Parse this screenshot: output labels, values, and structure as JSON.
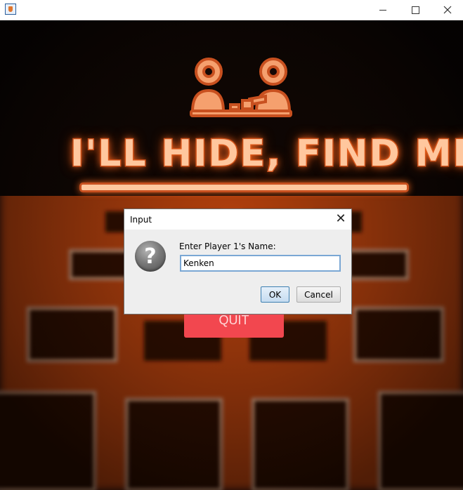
{
  "window": {
    "minimize_icon": "minimize-icon",
    "maximize_icon": "maximize-icon",
    "close_icon": "close-icon"
  },
  "game": {
    "title": "I'LL HIDE, FIND ME!",
    "quit_label": "QUIT",
    "colors": {
      "glow": "#f0651e",
      "title_fill": "#ffc79e",
      "title_stroke": "#c8501f",
      "quit_button": "#f2474f"
    }
  },
  "dialog": {
    "title": "Input",
    "close_glyph": "✕",
    "icon": "question-icon",
    "question_glyph": "?",
    "prompt": "Enter Player 1's Name:",
    "input_value": "Kenken",
    "ok_label": "OK",
    "cancel_label": "Cancel"
  }
}
